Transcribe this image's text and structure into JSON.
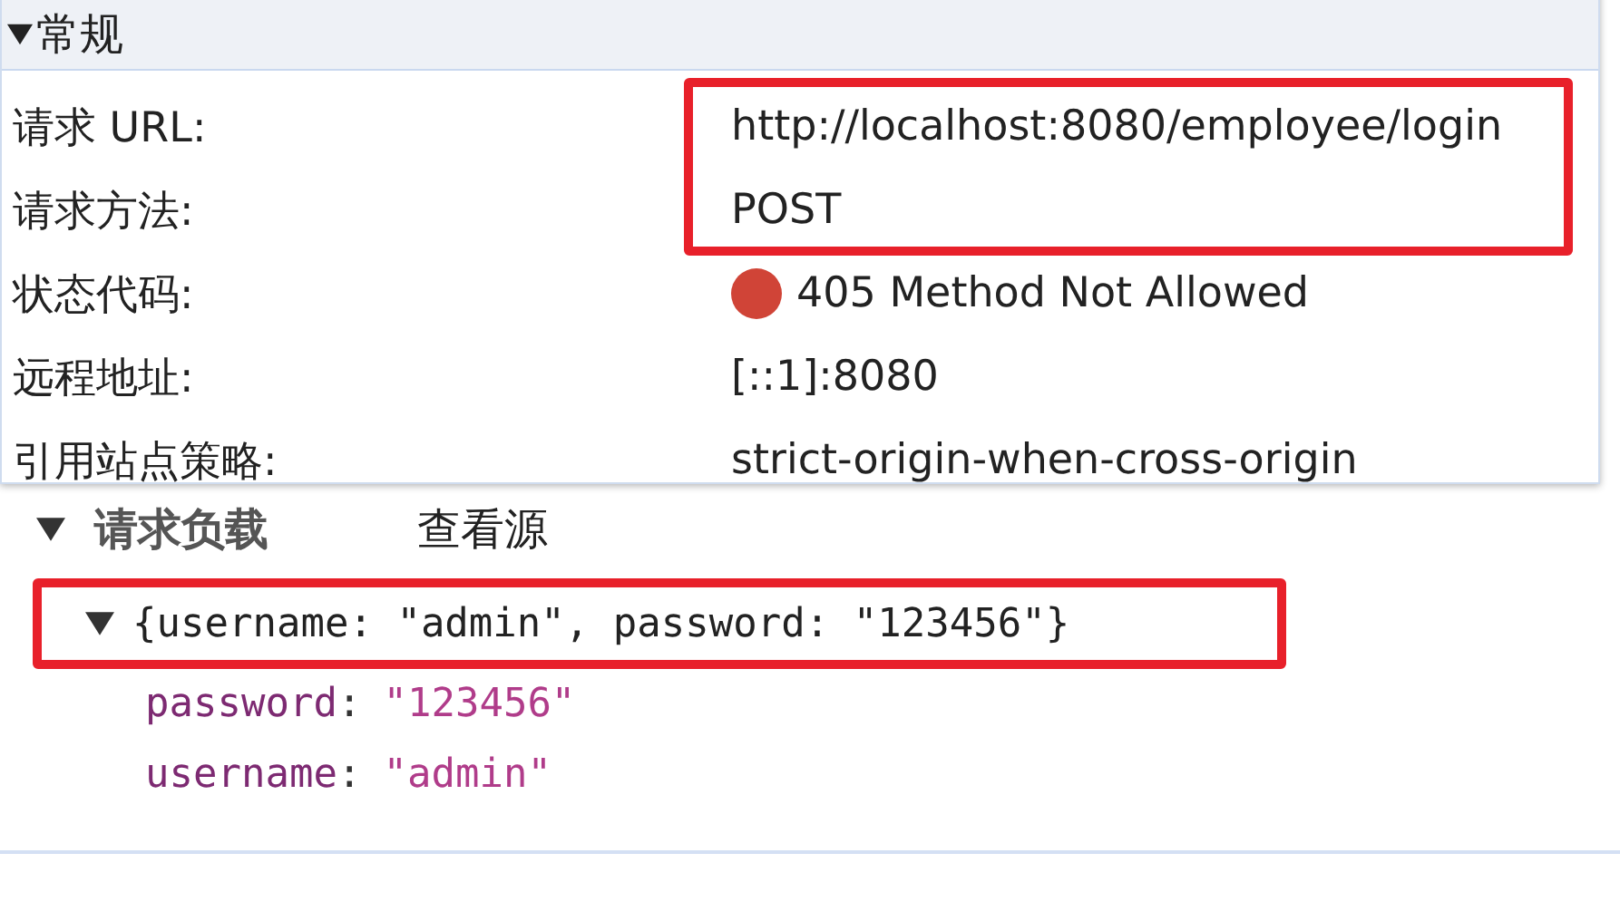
{
  "general": {
    "title": "常规",
    "expanded": true,
    "rows": [
      {
        "label": "请求 URL:",
        "value": "http://localhost:8080/employee/login",
        "highlighted": true
      },
      {
        "label": "请求方法:",
        "value": "POST",
        "highlighted": true
      },
      {
        "label": "状态代码:",
        "value": "405 Method Not Allowed",
        "highlighted": false,
        "color": "#d04437"
      },
      {
        "label": "远程地址:",
        "value": "[::1]:8080",
        "highlighted": false
      },
      {
        "label": "引用站点策略:",
        "value": "strict-origin-when-cross-origin",
        "highlighted": false
      }
    ]
  },
  "payload": {
    "title": "请求负载",
    "expanded": true,
    "view_source": "查看源",
    "summary": {
      "text": "{username: \"admin\", password: \"123456\"}",
      "expanded": true,
      "highlighted": true
    },
    "properties": [
      {
        "key": "password",
        "separator": ":",
        "value": "\"123456\""
      },
      {
        "key": "username",
        "separator": ":",
        "value": "\"admin\""
      }
    ]
  }
}
